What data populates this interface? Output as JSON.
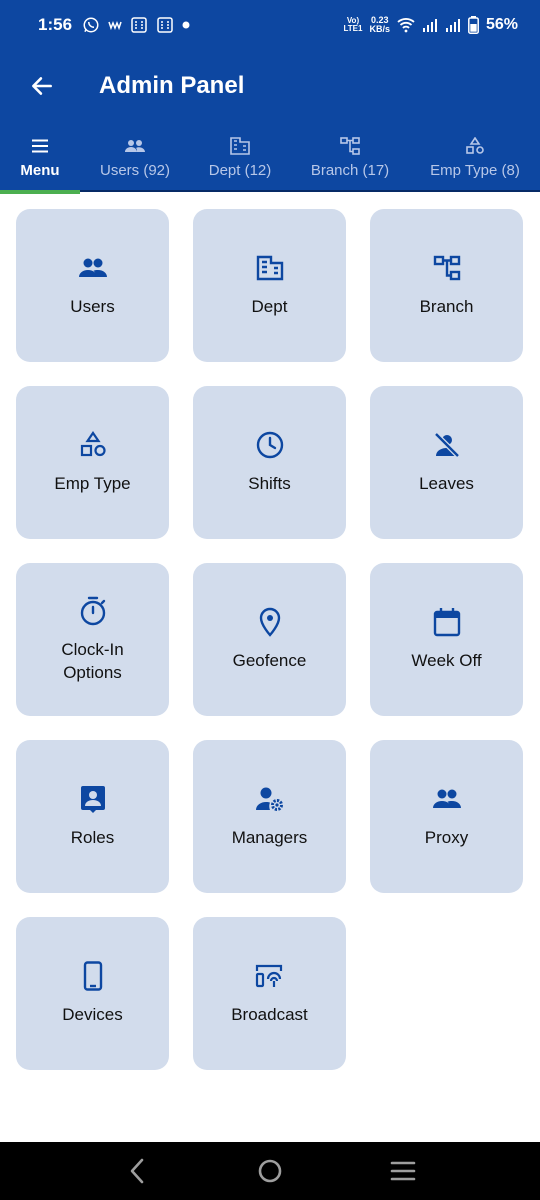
{
  "status_bar": {
    "time": "1:56",
    "net_speed_value": "0.23",
    "net_speed_unit": "KB/s",
    "lte_top": "Vo)",
    "lte_bottom": "LTE1",
    "battery": "56%"
  },
  "app_bar": {
    "title": "Admin Panel"
  },
  "tabs": [
    {
      "label": "Menu",
      "icon": "menu-icon"
    },
    {
      "label": "Users (92)",
      "icon": "people-icon"
    },
    {
      "label": "Dept (12)",
      "icon": "building-icon"
    },
    {
      "label": "Branch (17)",
      "icon": "tree-icon"
    },
    {
      "label": "Emp Type (8)",
      "icon": "shapes-icon"
    }
  ],
  "menu_cards": [
    {
      "label": "Users",
      "icon": "people-icon"
    },
    {
      "label": "Dept",
      "icon": "building-icon"
    },
    {
      "label": "Branch",
      "icon": "tree-icon"
    },
    {
      "label": "Emp Type",
      "icon": "shapes-icon"
    },
    {
      "label": "Shifts",
      "icon": "clock-icon"
    },
    {
      "label": "Leaves",
      "icon": "person-off-icon"
    },
    {
      "label": "Clock-In\nOptions",
      "icon": "timer-icon"
    },
    {
      "label": "Geofence",
      "icon": "location-pin-icon"
    },
    {
      "label": "Week Off",
      "icon": "calendar-icon"
    },
    {
      "label": "Roles",
      "icon": "badge-icon"
    },
    {
      "label": "Managers",
      "icon": "manage-accounts-icon"
    },
    {
      "label": "Proxy",
      "icon": "people-icon"
    },
    {
      "label": "Devices",
      "icon": "phone-icon"
    },
    {
      "label": "Broadcast",
      "icon": "broadcast-icon"
    }
  ],
  "colors": {
    "primary": "#0d47a1",
    "card_bg": "#d2dcec",
    "active_indicator": "#4caf50"
  }
}
